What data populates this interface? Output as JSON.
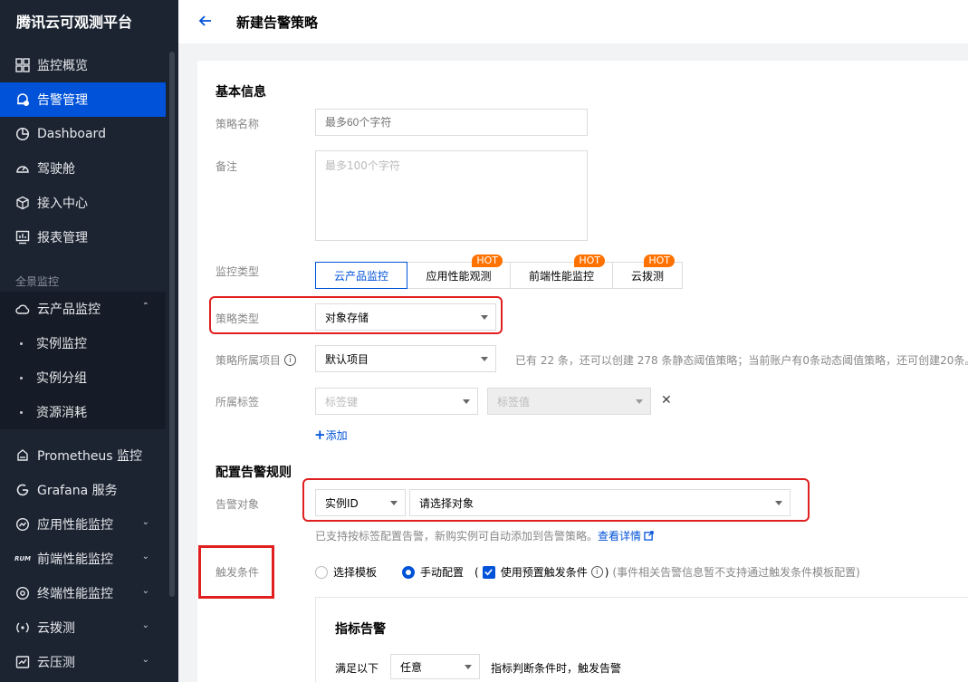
{
  "sidebar": {
    "brand": "腾讯云可观测平台",
    "items": [
      {
        "label": "监控概览",
        "icon": "grid-icon"
      },
      {
        "label": "告警管理",
        "icon": "alarm-bell-icon"
      },
      {
        "label": "Dashboard",
        "icon": "pie-chart-icon"
      },
      {
        "label": "驾驶舱",
        "icon": "gauge-icon"
      },
      {
        "label": "接入中心",
        "icon": "cube-icon"
      },
      {
        "label": "报表管理",
        "icon": "report-icon"
      }
    ],
    "group_label": "全景监控",
    "cloud_product": {
      "label": "云产品监控",
      "icon": "cloud-icon"
    },
    "sub_items": [
      "实例监控",
      "实例分组",
      "资源消耗"
    ],
    "more_items": [
      {
        "label": "Prometheus 监控",
        "icon": "prometheus-icon"
      },
      {
        "label": "Grafana 服务",
        "icon": "grafana-icon"
      },
      {
        "label": "应用性能监控",
        "icon": "apm-icon"
      },
      {
        "label": "前端性能监控",
        "icon": "rum-icon"
      },
      {
        "label": "终端性能监控",
        "icon": "terminal-icon"
      },
      {
        "label": "云拨测",
        "icon": "probe-icon"
      },
      {
        "label": "云压测",
        "icon": "stress-icon"
      }
    ],
    "rum_badge": "RUM"
  },
  "header": {
    "title": "新建告警策略"
  },
  "basic": {
    "section_title": "基本信息",
    "name_label": "策略名称",
    "name_placeholder": "最多60个字符",
    "remark_label": "备注",
    "remark_placeholder": "最多100个字符",
    "monitor_type_label": "监控类型",
    "monitor_types": [
      "云产品监控",
      "应用性能观测",
      "前端性能监控",
      "云拨测"
    ],
    "hot_badge": "HOT",
    "policy_type_label": "策略类型",
    "policy_type_value": "对象存储",
    "project_label": "策略所属项目",
    "project_value": "默认项目",
    "project_hint": "已有 22 条，还可以创建 278 条静态阈值策略；当前账户有0条动态阈值策略，还可创建20条。",
    "tag_label": "所属标签",
    "tag_key_placeholder": "标签键",
    "tag_value_placeholder": "标签值",
    "add_label": "添加"
  },
  "rules": {
    "section_title": "配置告警规则",
    "object_label": "告警对象",
    "object_type": "实例ID",
    "object_placeholder": "请选择对象",
    "object_hint": "已支持按标签配置告警，新购实例可自动添加到告警策略。",
    "object_link": "查看详情",
    "trigger_label": "触发条件",
    "trigger_template": "选择模板",
    "trigger_manual": "手动配置",
    "trigger_preset": "使用预置触发条件",
    "trigger_note": "(事件相关告警信息暂不支持通过触发条件模板配置)",
    "metric_title": "指标告警",
    "meet_label": "满足以下",
    "meet_value": "任意",
    "meet_suffix": "指标判断条件时，触发告警"
  }
}
